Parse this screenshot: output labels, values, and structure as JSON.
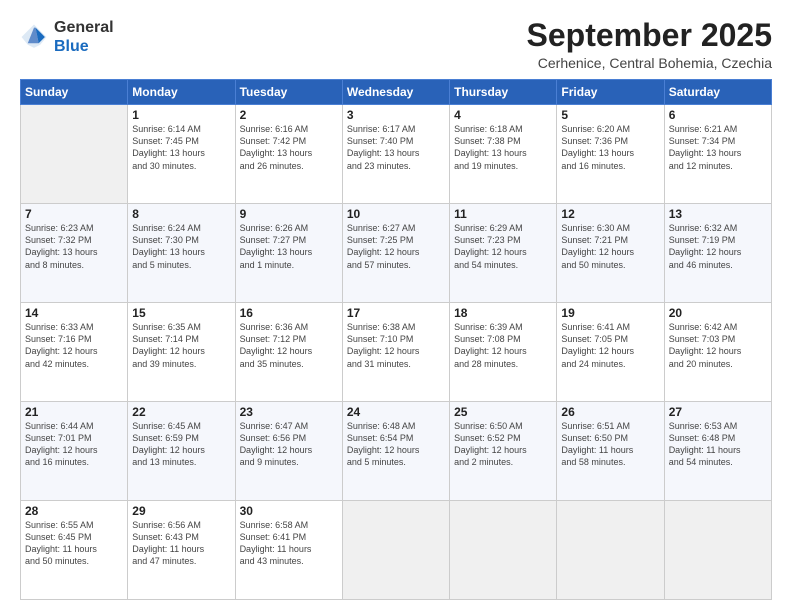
{
  "logo": {
    "general": "General",
    "blue": "Blue"
  },
  "title": "September 2025",
  "subtitle": "Cerhenice, Central Bohemia, Czechia",
  "days_of_week": [
    "Sunday",
    "Monday",
    "Tuesday",
    "Wednesday",
    "Thursday",
    "Friday",
    "Saturday"
  ],
  "weeks": [
    [
      {
        "day": "",
        "info": ""
      },
      {
        "day": "1",
        "info": "Sunrise: 6:14 AM\nSunset: 7:45 PM\nDaylight: 13 hours\nand 30 minutes."
      },
      {
        "day": "2",
        "info": "Sunrise: 6:16 AM\nSunset: 7:42 PM\nDaylight: 13 hours\nand 26 minutes."
      },
      {
        "day": "3",
        "info": "Sunrise: 6:17 AM\nSunset: 7:40 PM\nDaylight: 13 hours\nand 23 minutes."
      },
      {
        "day": "4",
        "info": "Sunrise: 6:18 AM\nSunset: 7:38 PM\nDaylight: 13 hours\nand 19 minutes."
      },
      {
        "day": "5",
        "info": "Sunrise: 6:20 AM\nSunset: 7:36 PM\nDaylight: 13 hours\nand 16 minutes."
      },
      {
        "day": "6",
        "info": "Sunrise: 6:21 AM\nSunset: 7:34 PM\nDaylight: 13 hours\nand 12 minutes."
      }
    ],
    [
      {
        "day": "7",
        "info": "Sunrise: 6:23 AM\nSunset: 7:32 PM\nDaylight: 13 hours\nand 8 minutes."
      },
      {
        "day": "8",
        "info": "Sunrise: 6:24 AM\nSunset: 7:30 PM\nDaylight: 13 hours\nand 5 minutes."
      },
      {
        "day": "9",
        "info": "Sunrise: 6:26 AM\nSunset: 7:27 PM\nDaylight: 13 hours\nand 1 minute."
      },
      {
        "day": "10",
        "info": "Sunrise: 6:27 AM\nSunset: 7:25 PM\nDaylight: 12 hours\nand 57 minutes."
      },
      {
        "day": "11",
        "info": "Sunrise: 6:29 AM\nSunset: 7:23 PM\nDaylight: 12 hours\nand 54 minutes."
      },
      {
        "day": "12",
        "info": "Sunrise: 6:30 AM\nSunset: 7:21 PM\nDaylight: 12 hours\nand 50 minutes."
      },
      {
        "day": "13",
        "info": "Sunrise: 6:32 AM\nSunset: 7:19 PM\nDaylight: 12 hours\nand 46 minutes."
      }
    ],
    [
      {
        "day": "14",
        "info": "Sunrise: 6:33 AM\nSunset: 7:16 PM\nDaylight: 12 hours\nand 42 minutes."
      },
      {
        "day": "15",
        "info": "Sunrise: 6:35 AM\nSunset: 7:14 PM\nDaylight: 12 hours\nand 39 minutes."
      },
      {
        "day": "16",
        "info": "Sunrise: 6:36 AM\nSunset: 7:12 PM\nDaylight: 12 hours\nand 35 minutes."
      },
      {
        "day": "17",
        "info": "Sunrise: 6:38 AM\nSunset: 7:10 PM\nDaylight: 12 hours\nand 31 minutes."
      },
      {
        "day": "18",
        "info": "Sunrise: 6:39 AM\nSunset: 7:08 PM\nDaylight: 12 hours\nand 28 minutes."
      },
      {
        "day": "19",
        "info": "Sunrise: 6:41 AM\nSunset: 7:05 PM\nDaylight: 12 hours\nand 24 minutes."
      },
      {
        "day": "20",
        "info": "Sunrise: 6:42 AM\nSunset: 7:03 PM\nDaylight: 12 hours\nand 20 minutes."
      }
    ],
    [
      {
        "day": "21",
        "info": "Sunrise: 6:44 AM\nSunset: 7:01 PM\nDaylight: 12 hours\nand 16 minutes."
      },
      {
        "day": "22",
        "info": "Sunrise: 6:45 AM\nSunset: 6:59 PM\nDaylight: 12 hours\nand 13 minutes."
      },
      {
        "day": "23",
        "info": "Sunrise: 6:47 AM\nSunset: 6:56 PM\nDaylight: 12 hours\nand 9 minutes."
      },
      {
        "day": "24",
        "info": "Sunrise: 6:48 AM\nSunset: 6:54 PM\nDaylight: 12 hours\nand 5 minutes."
      },
      {
        "day": "25",
        "info": "Sunrise: 6:50 AM\nSunset: 6:52 PM\nDaylight: 12 hours\nand 2 minutes."
      },
      {
        "day": "26",
        "info": "Sunrise: 6:51 AM\nSunset: 6:50 PM\nDaylight: 11 hours\nand 58 minutes."
      },
      {
        "day": "27",
        "info": "Sunrise: 6:53 AM\nSunset: 6:48 PM\nDaylight: 11 hours\nand 54 minutes."
      }
    ],
    [
      {
        "day": "28",
        "info": "Sunrise: 6:55 AM\nSunset: 6:45 PM\nDaylight: 11 hours\nand 50 minutes."
      },
      {
        "day": "29",
        "info": "Sunrise: 6:56 AM\nSunset: 6:43 PM\nDaylight: 11 hours\nand 47 minutes."
      },
      {
        "day": "30",
        "info": "Sunrise: 6:58 AM\nSunset: 6:41 PM\nDaylight: 11 hours\nand 43 minutes."
      },
      {
        "day": "",
        "info": ""
      },
      {
        "day": "",
        "info": ""
      },
      {
        "day": "",
        "info": ""
      },
      {
        "day": "",
        "info": ""
      }
    ]
  ]
}
